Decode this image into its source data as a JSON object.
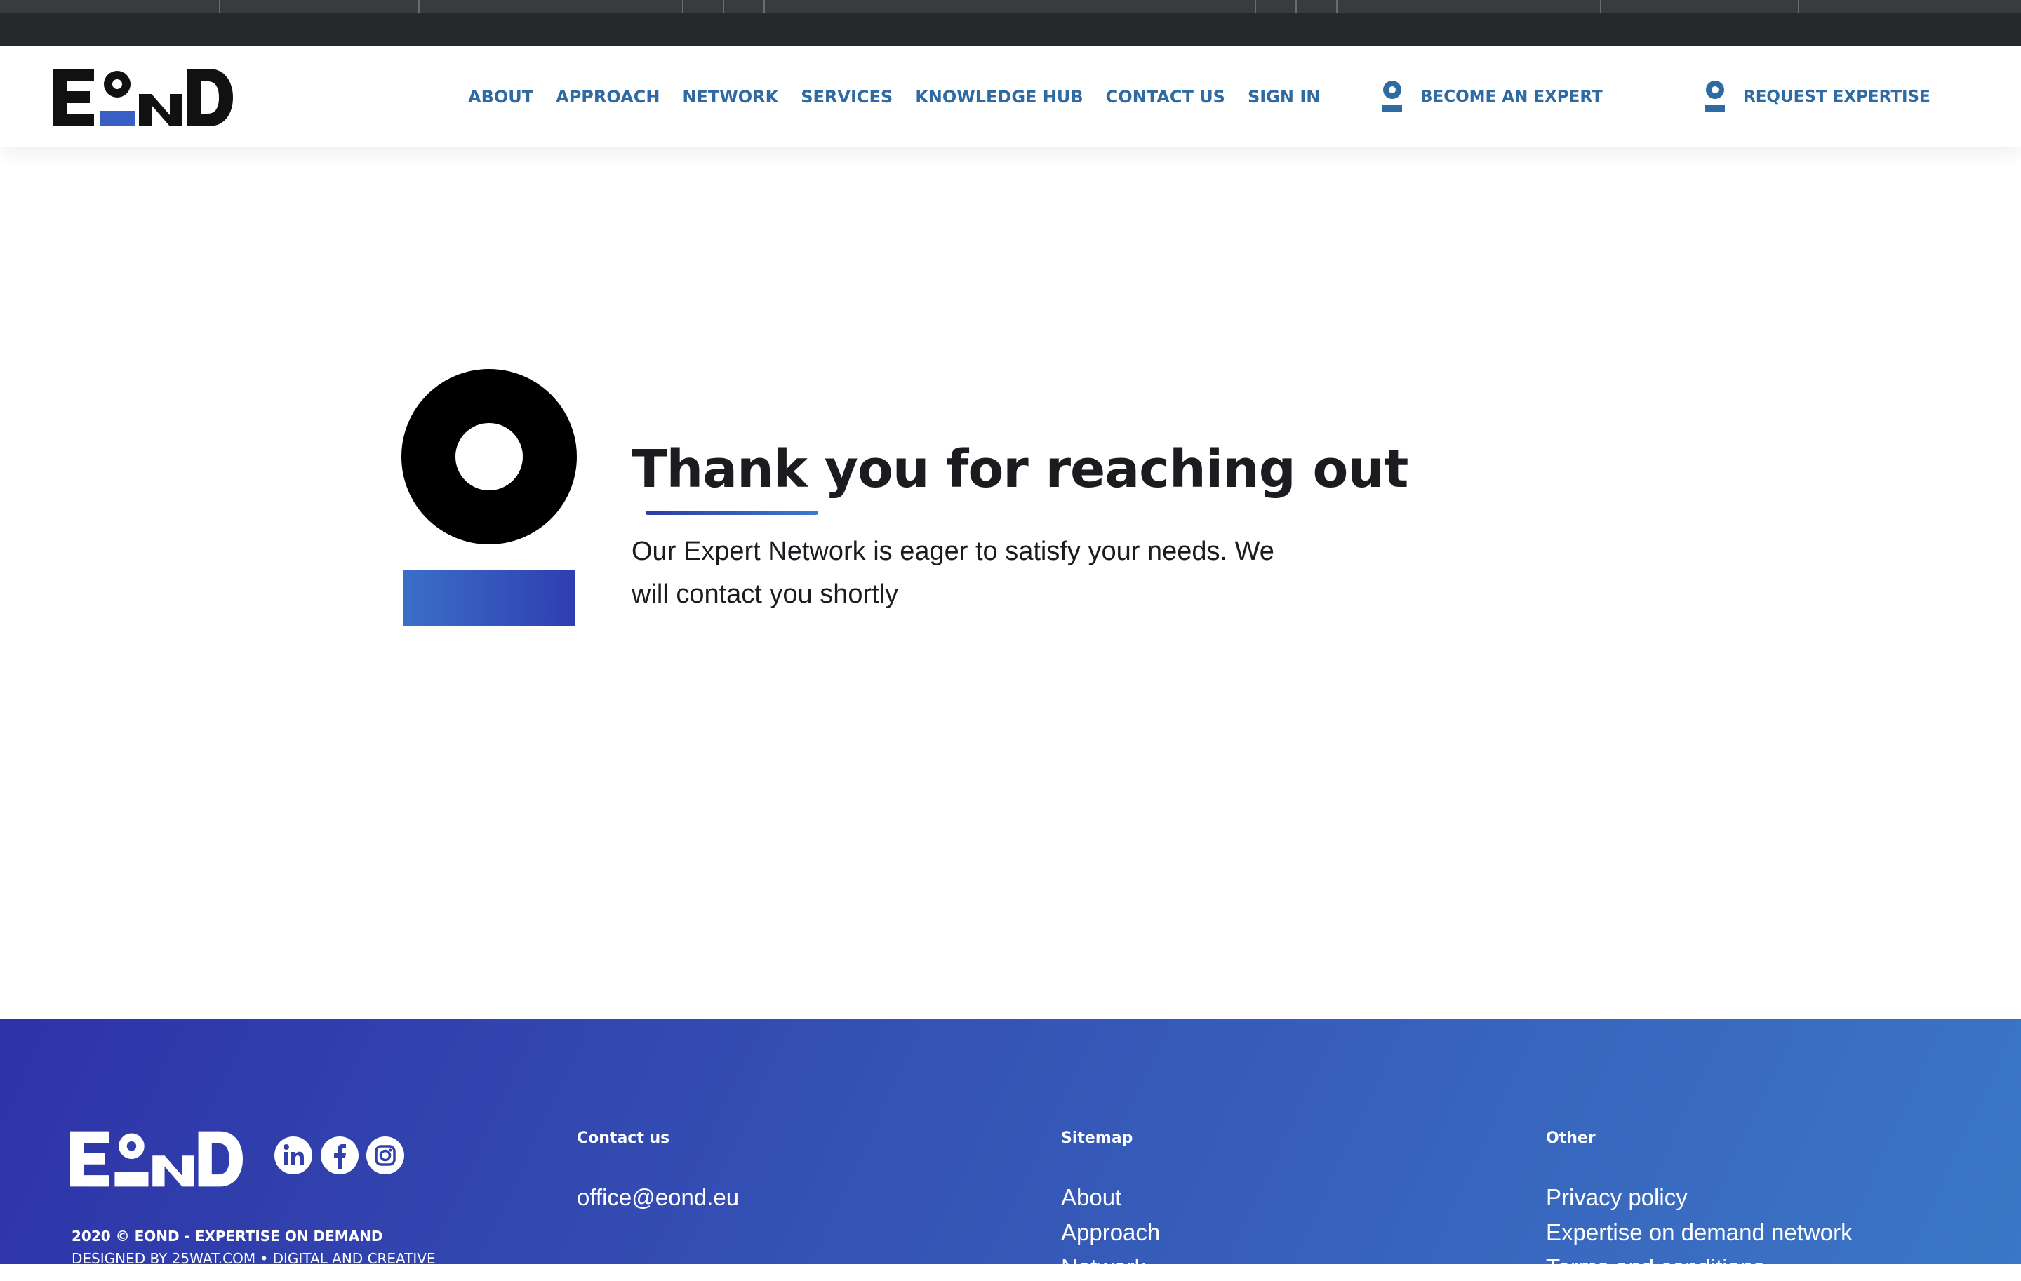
{
  "header": {
    "logo_text": "EOND",
    "nav": [
      "ABOUT",
      "APPROACH",
      "NETWORK",
      "SERVICES",
      "KNOWLEDGE HUB",
      "CONTACT US",
      "SIGN IN"
    ],
    "become_expert": "BECOME AN EXPERT",
    "request_expertise": "REQUEST EXPERTISE"
  },
  "main": {
    "title": "Thank you for reaching out",
    "message": "Our Expert Network is eager to satisfy your needs. We will contact you shortly"
  },
  "footer": {
    "logo_text": "EOND",
    "copyright": "2020 © EOND - EXPERTISE ON DEMAND",
    "designed_by": "DESIGNED BY 25WAT.COM • DIGITAL AND CREATIVE",
    "contact": {
      "title": "Contact us",
      "email": "office@eond.eu"
    },
    "sitemap": {
      "title": "Sitemap",
      "links": [
        "About",
        "Approach",
        "Network"
      ]
    },
    "other": {
      "title": "Other",
      "links": [
        "Privacy policy",
        "Expertise on demand network",
        "Terms and conditions"
      ]
    },
    "social_icons": [
      "linkedin-icon",
      "facebook-icon",
      "instagram-icon"
    ]
  },
  "colors": {
    "nav_blue": "#2f6aa3",
    "footer_start": "#2e33a8",
    "footer_end": "#3b77c6",
    "text_dark": "#1b1c1f"
  }
}
